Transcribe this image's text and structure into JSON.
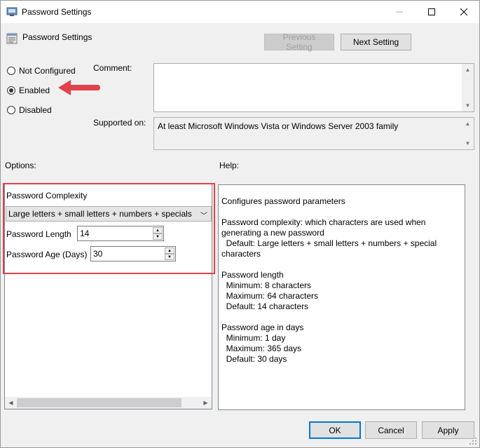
{
  "window": {
    "title": "Password Settings"
  },
  "header": {
    "title": "Password Settings"
  },
  "nav": {
    "previous_label": "Previous Setting",
    "next_label": "Next Setting"
  },
  "state": {
    "options": [
      "Not Configured",
      "Enabled",
      "Disabled"
    ],
    "selected": "Enabled"
  },
  "comment": {
    "label": "Comment:",
    "value": ""
  },
  "supported": {
    "label": "Supported on:",
    "value": "At least Microsoft Windows Vista or Windows Server 2003 family"
  },
  "options_panel": {
    "label": "Options:",
    "complexity_label": "Password Complexity",
    "complexity_value": "Large letters + small letters + numbers + specials",
    "length_label": "Password Length",
    "length_value": "14",
    "age_label": "Password Age (Days)",
    "age_value": "30"
  },
  "help": {
    "label": "Help:",
    "text": "Configures password parameters\n\nPassword complexity: which characters are used when\ngenerating a new password\n  Default: Large letters + small letters + numbers + special\ncharacters\n\nPassword length\n  Minimum: 8 characters\n  Maximum: 64 characters\n  Default: 14 characters\n\nPassword age in days\n  Minimum: 1 day\n  Maximum: 365 days\n  Default: 30 days"
  },
  "footer": {
    "ok_label": "OK",
    "cancel_label": "Cancel",
    "apply_label": "Apply"
  },
  "colors": {
    "highlight": "#e0414a",
    "accent": "#0078d7"
  }
}
